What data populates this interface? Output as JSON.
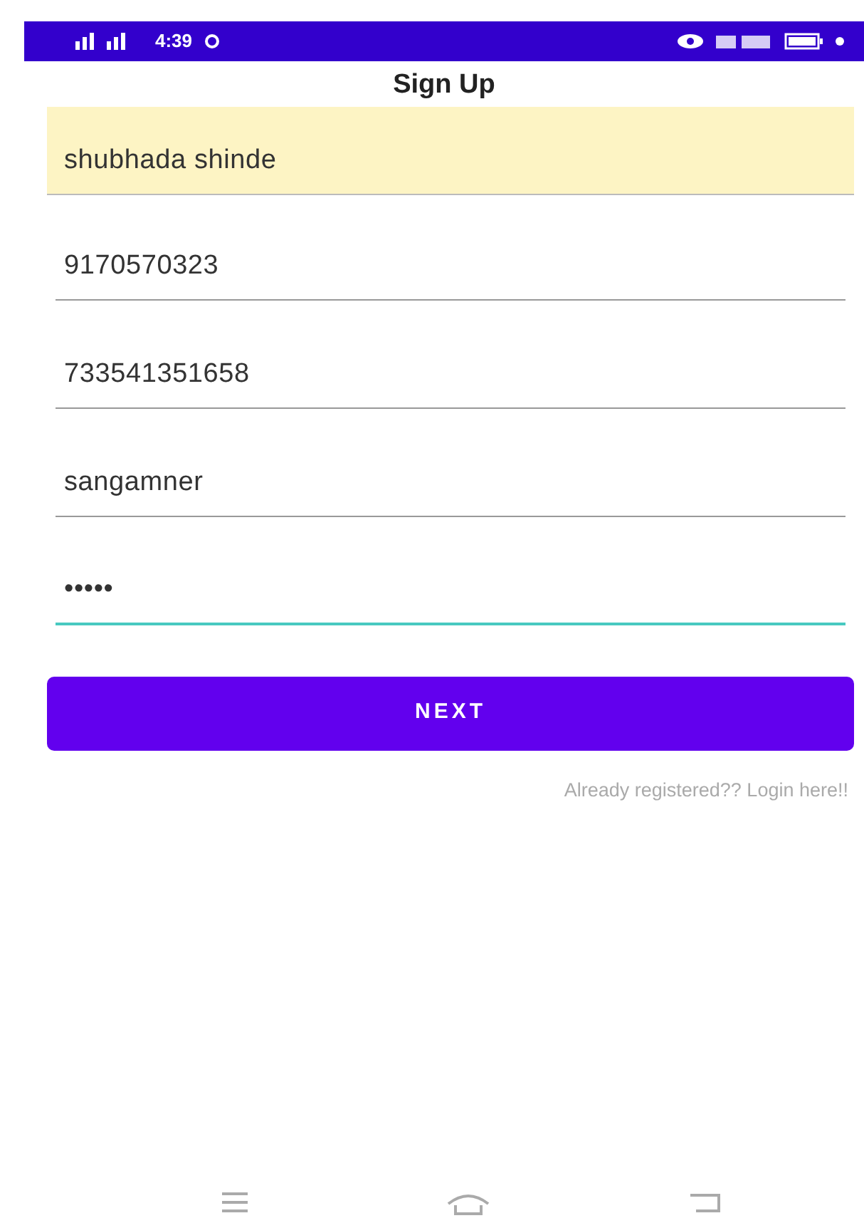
{
  "status_bar": {
    "time": "4:39"
  },
  "title": "Sign Up",
  "fields": [
    {
      "value": "shubhada shinde",
      "autofilled": true,
      "focused": false
    },
    {
      "value": "9170570323",
      "autofilled": false,
      "focused": false
    },
    {
      "value": "733541351658",
      "autofilled": false,
      "focused": false
    },
    {
      "value": "sangamner",
      "autofilled": false,
      "focused": false
    },
    {
      "value": "•••••",
      "autofilled": false,
      "focused": true
    }
  ],
  "button": {
    "label": "NEXT"
  },
  "login_link": "Already registered?? Login here!!"
}
